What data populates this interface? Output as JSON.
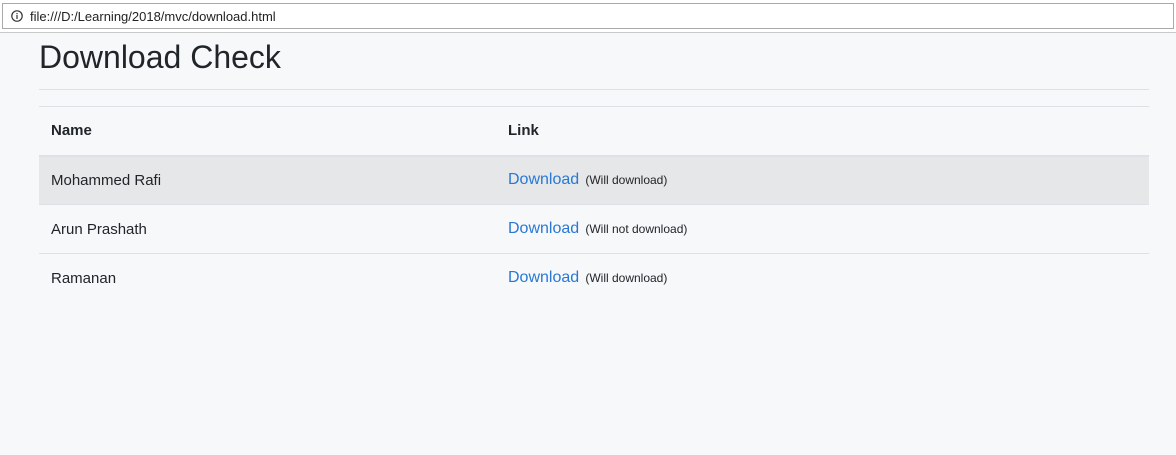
{
  "browser": {
    "url": "file:///D:/Learning/2018/mvc/download.html"
  },
  "page": {
    "title": "Download Check"
  },
  "table": {
    "headers": [
      "Name",
      "Link"
    ],
    "rows": [
      {
        "name": "Mohammed Rafi",
        "link_label": "Download",
        "note": "(Will download)"
      },
      {
        "name": "Arun Prashath",
        "link_label": "Download",
        "note": "(Will not download)"
      },
      {
        "name": "Ramanan",
        "link_label": "Download",
        "note": "(Will download)"
      }
    ]
  }
}
